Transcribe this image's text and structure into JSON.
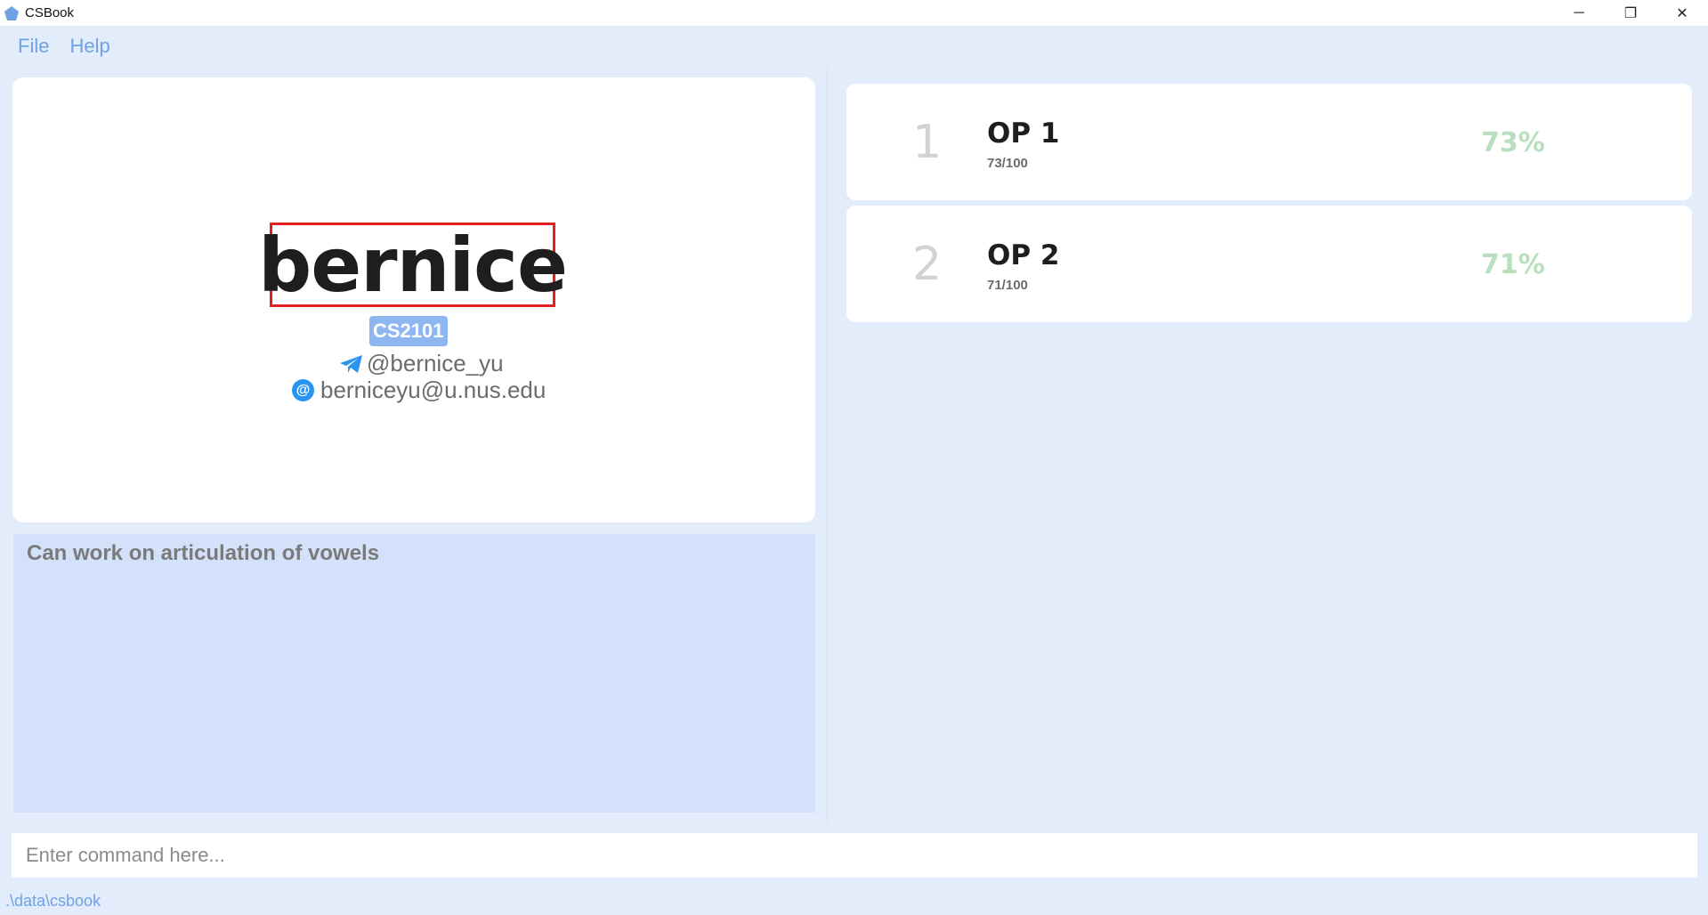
{
  "window": {
    "title": "CSBook",
    "controls": {
      "minimize": "─",
      "restore": "❐",
      "close": "✕"
    }
  },
  "menu": {
    "items": [
      {
        "label": "File"
      },
      {
        "label": "Help"
      }
    ]
  },
  "student": {
    "name": "bernice",
    "tag": "CS2101",
    "telegram": "@bernice_yu",
    "email": "berniceyu@u.nus.edu",
    "note": "Can work on articulation of vowels"
  },
  "assessments": [
    {
      "index": "1",
      "title": "OP 1",
      "score": "73/100",
      "percent": "73%"
    },
    {
      "index": "2",
      "title": "OP 2",
      "score": "71/100",
      "percent": "71%"
    }
  ],
  "command": {
    "placeholder": "Enter command here...",
    "value": ""
  },
  "status": {
    "path": ".\\data\\csbook"
  },
  "colors": {
    "background": "#e3ecfa",
    "accent": "#6fa2e2",
    "tag": "#8eb6f0",
    "highlight_border": "#e32020",
    "percent": "#b9dfbf",
    "notes_panel": "#d3e2fa"
  },
  "icons": {
    "app": "app-logo-icon",
    "telegram": "telegram-icon",
    "email": "at-icon"
  }
}
